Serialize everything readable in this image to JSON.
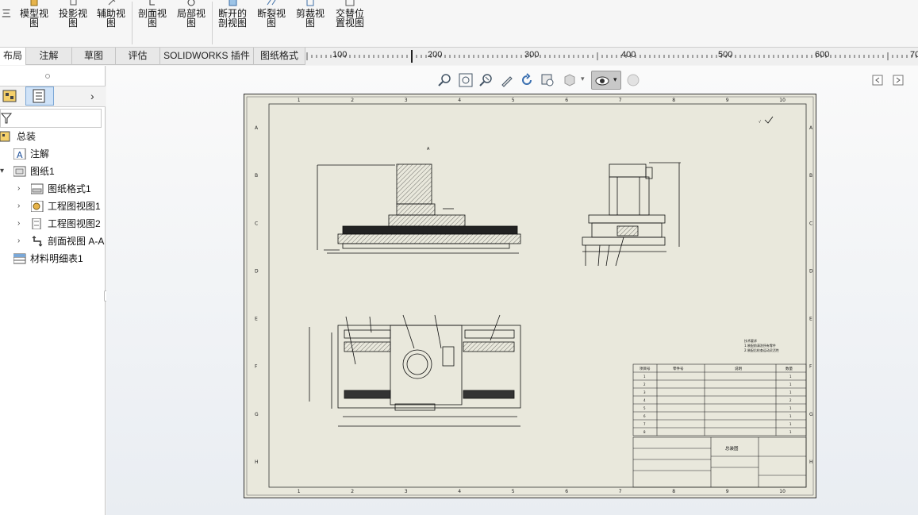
{
  "ribbon": {
    "buttons": [
      {
        "label": "三",
        "icon": "three-view-icon"
      },
      {
        "label": "模型视\n图",
        "icon": "model-view-icon"
      },
      {
        "label": "投影视\n图",
        "icon": "projected-view-icon"
      },
      {
        "label": "辅助视\n图",
        "icon": "auxiliary-view-icon"
      },
      {
        "label": "剖面视\n图",
        "icon": "section-view-icon"
      },
      {
        "label": "局部视\n图",
        "icon": "detail-view-icon"
      },
      {
        "label": "断开的\n剖视图",
        "icon": "broken-out-section-icon"
      },
      {
        "label": "断裂视\n图",
        "icon": "break-view-icon"
      },
      {
        "label": "剪裁视\n图",
        "icon": "crop-view-icon"
      },
      {
        "label": "交替位\n置视图",
        "icon": "alternate-position-view-icon"
      }
    ]
  },
  "tabs": [
    "布局",
    "注解",
    "草图",
    "评估",
    "SOLIDWORKS 插件",
    "图纸格式"
  ],
  "active_tab": "布局",
  "ruler": {
    "ticks": [
      "100",
      "200",
      "300",
      "400",
      "500",
      "600",
      "70"
    ]
  },
  "feature_tree": {
    "root": "总装",
    "items": [
      {
        "label": "注解",
        "icon": "annotations-icon"
      },
      {
        "label": "图纸1",
        "icon": "sheet-icon"
      },
      {
        "label": "图纸格式1",
        "icon": "sheet-format-icon"
      },
      {
        "label": "工程图视图1",
        "icon": "drawing-view-icon"
      },
      {
        "label": "工程图视图2",
        "icon": "drawing-view-icon"
      },
      {
        "label": "剖面视图 A-A",
        "icon": "section-view-icon"
      },
      {
        "label": "材料明细表1",
        "icon": "bom-table-icon"
      }
    ]
  },
  "drawing": {
    "border_col_labels": [
      "1",
      "2",
      "3",
      "4",
      "5",
      "6",
      "7",
      "8",
      "9",
      "10"
    ],
    "border_row_labels": [
      "A",
      "B",
      "C",
      "D",
      "E",
      "F",
      "G",
      "H"
    ],
    "bom_headers": [
      "项目号",
      "零件号",
      "说明",
      "数量"
    ],
    "bom_qty": [
      "1",
      "1",
      "1",
      "2",
      "1",
      "1",
      "1",
      "1"
    ],
    "title_block": {
      "name": "总装图"
    }
  },
  "colors": {
    "sheet": "#e9e8dc",
    "line": "#111111",
    "canvas": "#eef0f3"
  }
}
